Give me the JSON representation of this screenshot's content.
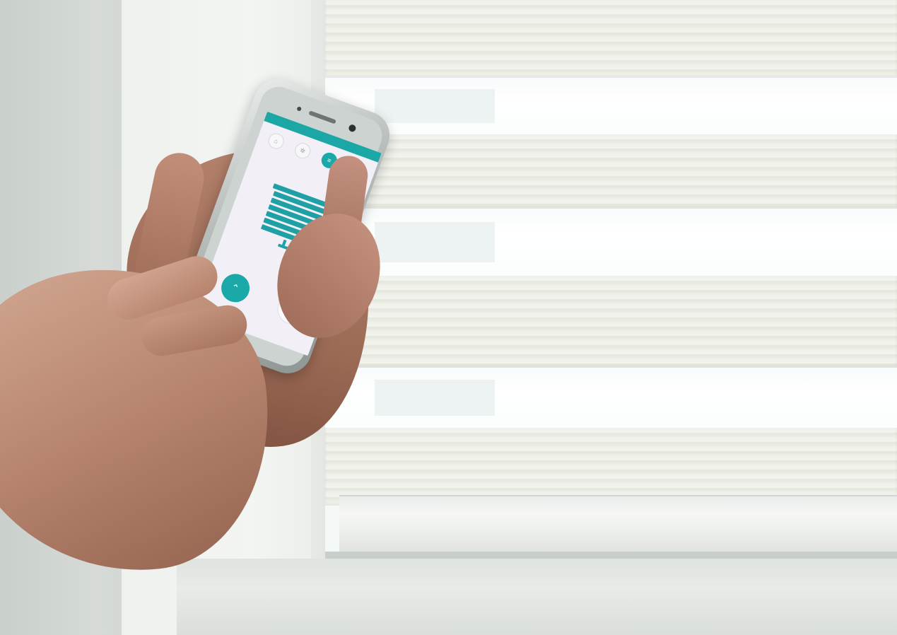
{
  "scene": {
    "description_type": "photo",
    "colors": {
      "accent": "#1aa9a8",
      "blind_fabric": "#eef0e8",
      "wall": "#f1f3f0",
      "skin": "#b8866f"
    }
  },
  "app": {
    "status_left": "",
    "status_right": "",
    "tabs": [
      {
        "label": "",
        "icon": "home-icon",
        "active": false
      },
      {
        "label": "",
        "icon": "dimmer-icon",
        "active": false
      },
      {
        "label": "",
        "icon": "blind-icon",
        "active": true
      },
      {
        "label": "",
        "icon": "settings-icon",
        "active": false
      }
    ],
    "blind_visual": {
      "icon": "window-blind-icon"
    },
    "buttons": [
      {
        "icon": "up-arrow-icon",
        "state": "pressed"
      },
      {
        "icon": "chevron-down-icon",
        "state": "idle"
      }
    ]
  }
}
